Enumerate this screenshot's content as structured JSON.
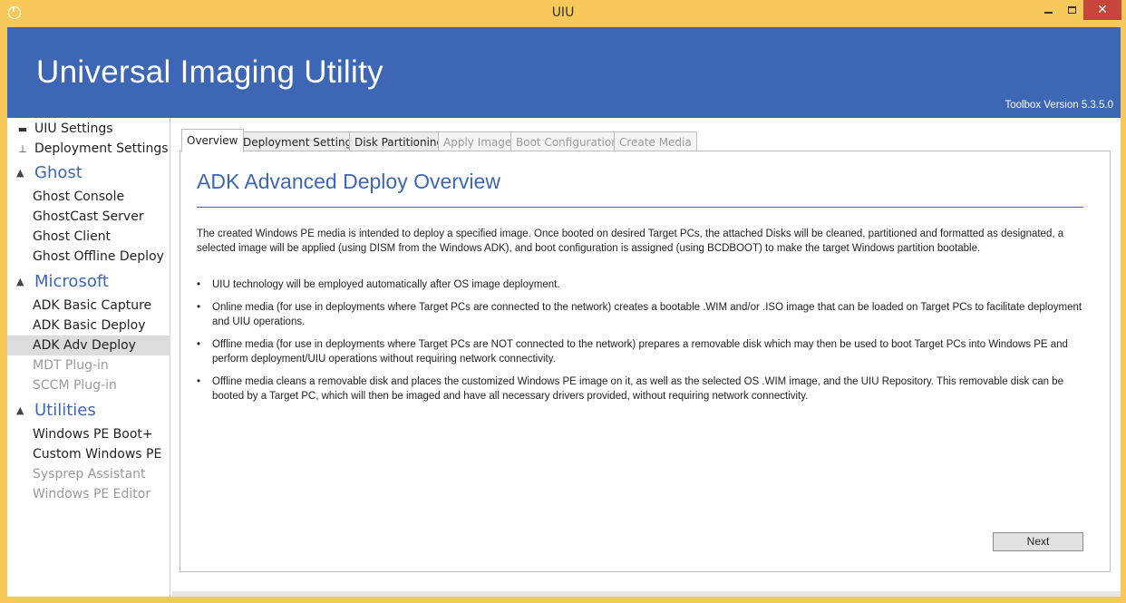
{
  "window": {
    "title": "UIU",
    "minimize_label": "",
    "close_label": "✕"
  },
  "banner": {
    "title": "Universal Imaging Utility",
    "version": "Toolbox Version 5.3.5.0"
  },
  "sidebar": {
    "top_items": [
      {
        "label": "UIU Settings",
        "icon": "toolbox-icon"
      },
      {
        "label": "Deployment Settings",
        "icon": "network-icon"
      }
    ],
    "categories": [
      {
        "label": "Ghost",
        "items": [
          {
            "label": "Ghost Console"
          },
          {
            "label": "GhostCast Server"
          },
          {
            "label": "Ghost Client"
          },
          {
            "label": "Ghost Offline Deploy"
          }
        ]
      },
      {
        "label": "Microsoft",
        "items": [
          {
            "label": "ADK Basic Capture"
          },
          {
            "label": "ADK Basic Deploy"
          },
          {
            "label": "ADK Adv Deploy"
          },
          {
            "label": "MDT Plug-in"
          },
          {
            "label": "SCCM Plug-in"
          }
        ]
      },
      {
        "label": "Utilities",
        "items": [
          {
            "label": "Windows PE Boot+"
          },
          {
            "label": "Custom Windows PE"
          },
          {
            "label": "Sysprep Assistant"
          },
          {
            "label": "Windows PE Editor"
          }
        ]
      }
    ]
  },
  "tabs": [
    {
      "label": "Overview"
    },
    {
      "label": "Deployment Settings"
    },
    {
      "label": "Disk Partitioning"
    },
    {
      "label": "Apply Image"
    },
    {
      "label": "Boot Configuration"
    },
    {
      "label": "Create Media"
    }
  ],
  "panel": {
    "title": "ADK Advanced Deploy Overview",
    "intro": "The created Windows PE media is intended to deploy a specified image. Once booted on desired Target PCs, the attached Disks will be cleaned, partitioned and formatted as designated, a selected image will be applied (using DISM from the Windows ADK), and boot configuration is assigned (using BCDBOOT) to make the target Windows partition bootable.",
    "bullet_symbol": "•",
    "bullets": [
      "UIU technology will be employed automatically after OS image deployment.",
      "Online media (for use in deployments where Target PCs are connected to the network) creates a bootable .WIM and/or .ISO image that can be loaded on Target PCs to facilitate deployment and UIU operations.",
      "Offline media (for use in deployments where Target PCs are NOT connected to the network) prepares a removable disk which may then be used to boot Target PCs into Windows PE and perform deployment/UIU operations without requiring network connectivity.",
      "Offline media cleans a removable disk and places the customized Windows PE image on it, as well as the selected OS .WIM image, and the UIU Repository. This removable disk can be booted by a Target PC, which will then be imaged and have all necessary drivers provided, without requiring network connectivity."
    ],
    "next_label": "Next"
  },
  "colors": {
    "window_frame": "#f7c95a",
    "banner": "#3d67b5",
    "accent_text": "#3d67b5",
    "close_button": "#c7463a"
  }
}
